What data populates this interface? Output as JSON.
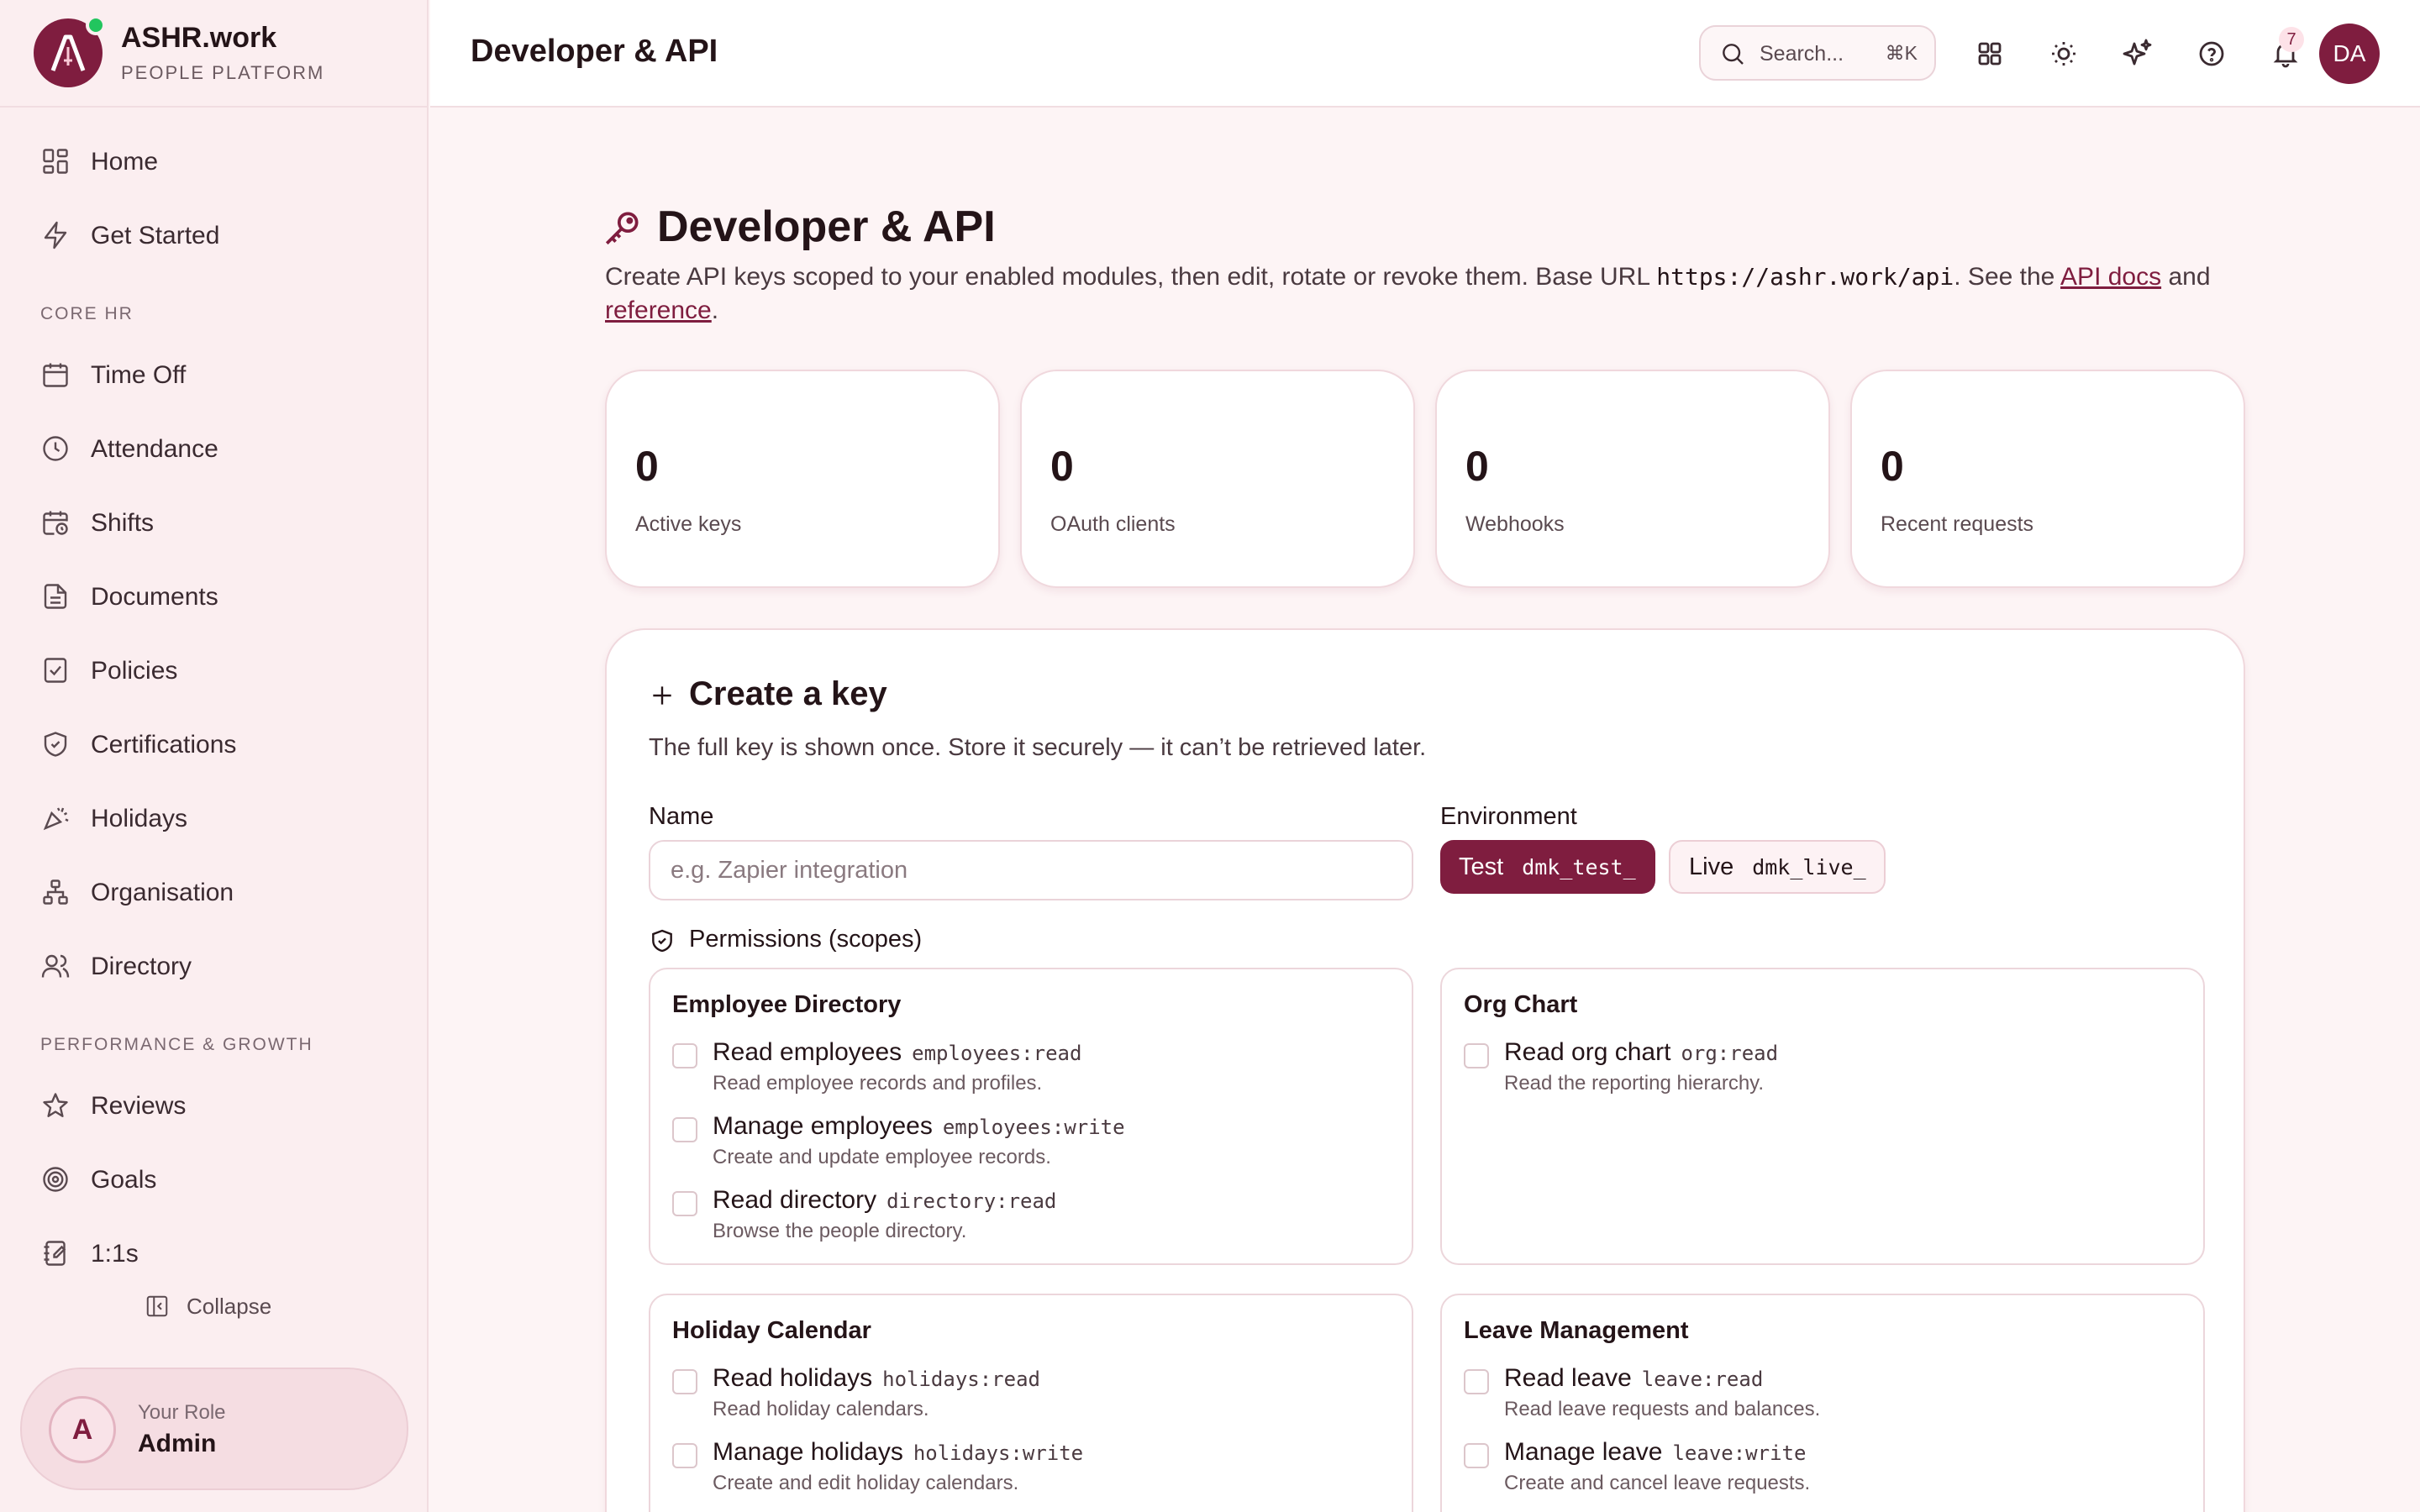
{
  "brand": {
    "name": "ASHR.work",
    "subtitle": "PEOPLE PLATFORM"
  },
  "sidebar": {
    "items": [
      {
        "label": "Home",
        "icon": "grid-icon"
      },
      {
        "label": "Get Started",
        "icon": "bolt-icon"
      }
    ],
    "sections": [
      {
        "title": "CORE HR",
        "items": [
          {
            "label": "Time Off",
            "icon": "calendar-icon"
          },
          {
            "label": "Attendance",
            "icon": "clock-icon"
          },
          {
            "label": "Shifts",
            "icon": "calendar-clock-icon"
          },
          {
            "label": "Documents",
            "icon": "document-icon"
          },
          {
            "label": "Policies",
            "icon": "policy-icon"
          },
          {
            "label": "Certifications",
            "icon": "shield-icon"
          },
          {
            "label": "Holidays",
            "icon": "party-icon"
          },
          {
            "label": "Organisation",
            "icon": "org-icon"
          },
          {
            "label": "Directory",
            "icon": "users-icon"
          }
        ]
      },
      {
        "title": "PERFORMANCE & GROWTH",
        "items": [
          {
            "label": "Reviews",
            "icon": "star-icon"
          },
          {
            "label": "Goals",
            "icon": "target-icon"
          },
          {
            "label": "1:1s",
            "icon": "notebook-icon"
          }
        ]
      }
    ],
    "collapse_label": "Collapse",
    "role": {
      "label": "Your Role",
      "value": "Admin",
      "avatar": "A"
    }
  },
  "header": {
    "title": "Developer & API",
    "search_placeholder": "Search...",
    "search_shortcut": "⌘K",
    "notification_count": "7",
    "user_initials": "DA"
  },
  "main": {
    "title": "Developer & API",
    "desc_prefix": "Create API keys scoped to your enabled modules, then edit, rotate or revoke them. Base URL ",
    "base_url": "https://ashr.work/api",
    "desc_mid": ". See the ",
    "docs_link": "API docs",
    "desc_and": " and ",
    "reference_link": "reference",
    "desc_end": ".",
    "stats": [
      {
        "value": "0",
        "label": "Active keys"
      },
      {
        "value": "0",
        "label": "OAuth clients"
      },
      {
        "value": "0",
        "label": "Webhooks"
      },
      {
        "value": "0",
        "label": "Recent requests"
      }
    ],
    "create": {
      "title": "Create a key",
      "description": "The full key is shown once. Store it securely — it can’t be retrieved later.",
      "name_label": "Name",
      "name_placeholder": "e.g. Zapier integration",
      "env_label": "Environment",
      "env_test_label": "Test",
      "env_test_prefix": "dmk_test_",
      "env_live_label": "Live",
      "env_live_prefix": "dmk_live_",
      "permissions_label": "Permissions (scopes)",
      "scope_groups": [
        {
          "title": "Employee Directory",
          "scopes": [
            {
              "name": "Read employees",
              "code": "employees:read",
              "desc": "Read employee records and profiles."
            },
            {
              "name": "Manage employees",
              "code": "employees:write",
              "desc": "Create and update employee records."
            },
            {
              "name": "Read directory",
              "code": "directory:read",
              "desc": "Browse the people directory."
            }
          ]
        },
        {
          "title": "Org Chart",
          "scopes": [
            {
              "name": "Read org chart",
              "code": "org:read",
              "desc": "Read the reporting hierarchy."
            }
          ]
        },
        {
          "title": "Holiday Calendar",
          "scopes": [
            {
              "name": "Read holidays",
              "code": "holidays:read",
              "desc": "Read holiday calendars."
            },
            {
              "name": "Manage holidays",
              "code": "holidays:write",
              "desc": "Create and edit holiday calendars."
            }
          ]
        },
        {
          "title": "Leave Management",
          "scopes": [
            {
              "name": "Read leave",
              "code": "leave:read",
              "desc": "Read leave requests and balances."
            },
            {
              "name": "Manage leave",
              "code": "leave:write",
              "desc": "Create and cancel leave requests."
            }
          ]
        }
      ]
    }
  },
  "colors": {
    "accent": "#7f1d3f",
    "background": "#fdf4f5",
    "online": "#22c55e"
  }
}
